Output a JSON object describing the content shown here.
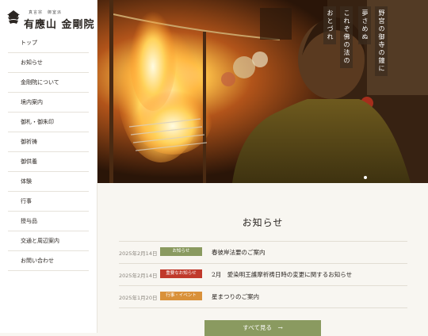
{
  "logo": {
    "small": "真言宗　御室派",
    "main": "有應山 金剛院"
  },
  "nav": [
    "トップ",
    "お知らせ",
    "金剛院について",
    "境内案内",
    "御札・御朱印",
    "御祈祷",
    "御供養",
    "体験",
    "行事",
    "授与品",
    "交通と周辺案内",
    "お問い合わせ"
  ],
  "hero": {
    "vertical_text": [
      "野宮の御寺の鐘に",
      "夢さめぬ",
      "これぞ佛の法の",
      "おとづれ"
    ]
  },
  "news": {
    "title": "お知らせ",
    "items": [
      {
        "date": "2025年2月14日",
        "badge": "お知らせ",
        "badge_color": "#8a9a60",
        "title": "春彼岸法要のご案内"
      },
      {
        "date": "2025年2月14日",
        "badge": "重要なお知らせ",
        "badge_color": "#c0392b",
        "title": "2月　愛染明王護摩祈祷日時の変更に関するお知らせ"
      },
      {
        "date": "2025年1月20日",
        "badge": "行事・イベント",
        "badge_color": "#d9913a",
        "title": "星まつりのご案内"
      }
    ],
    "more_label": "すべて見る　→"
  }
}
